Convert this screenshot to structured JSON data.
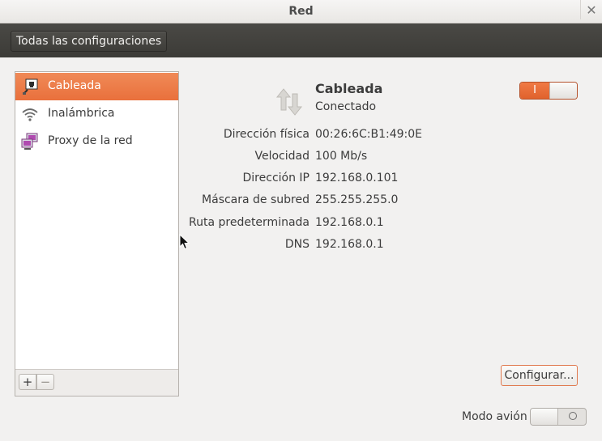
{
  "window": {
    "title": "Red"
  },
  "toolbar": {
    "all_settings_label": "Todas las configuraciones"
  },
  "sidebar": {
    "items": [
      {
        "label": "Cableada",
        "icon": "wired-network-icon",
        "active": true
      },
      {
        "label": "Inalámbrica",
        "icon": "wifi-icon",
        "active": false
      },
      {
        "label": "Proxy de la red",
        "icon": "network-proxy-icon",
        "active": false
      }
    ],
    "add_label": "+",
    "remove_label": "−"
  },
  "connection": {
    "name": "Cableada",
    "status": "Conectado",
    "switch_label": "I",
    "enabled": true,
    "details": [
      {
        "key": "Dirección física",
        "value": "00:26:6C:B1:49:0E"
      },
      {
        "key": "Velocidad",
        "value": "100 Mb/s"
      },
      {
        "key": "Dirección IP",
        "value": "192.168.0.101"
      },
      {
        "key": "Máscara de subred",
        "value": "255.255.255.0"
      },
      {
        "key": "Ruta predeterminada",
        "value": "192.168.0.1"
      },
      {
        "key": "DNS",
        "value": "192.168.0.1"
      }
    ],
    "configure_label": "Configurar..."
  },
  "airplane_mode": {
    "label": "Modo avión",
    "enabled": false
  },
  "colors": {
    "accent": "#e9703c",
    "toolbar": "#3c3b37",
    "background": "#f2f1f0"
  }
}
